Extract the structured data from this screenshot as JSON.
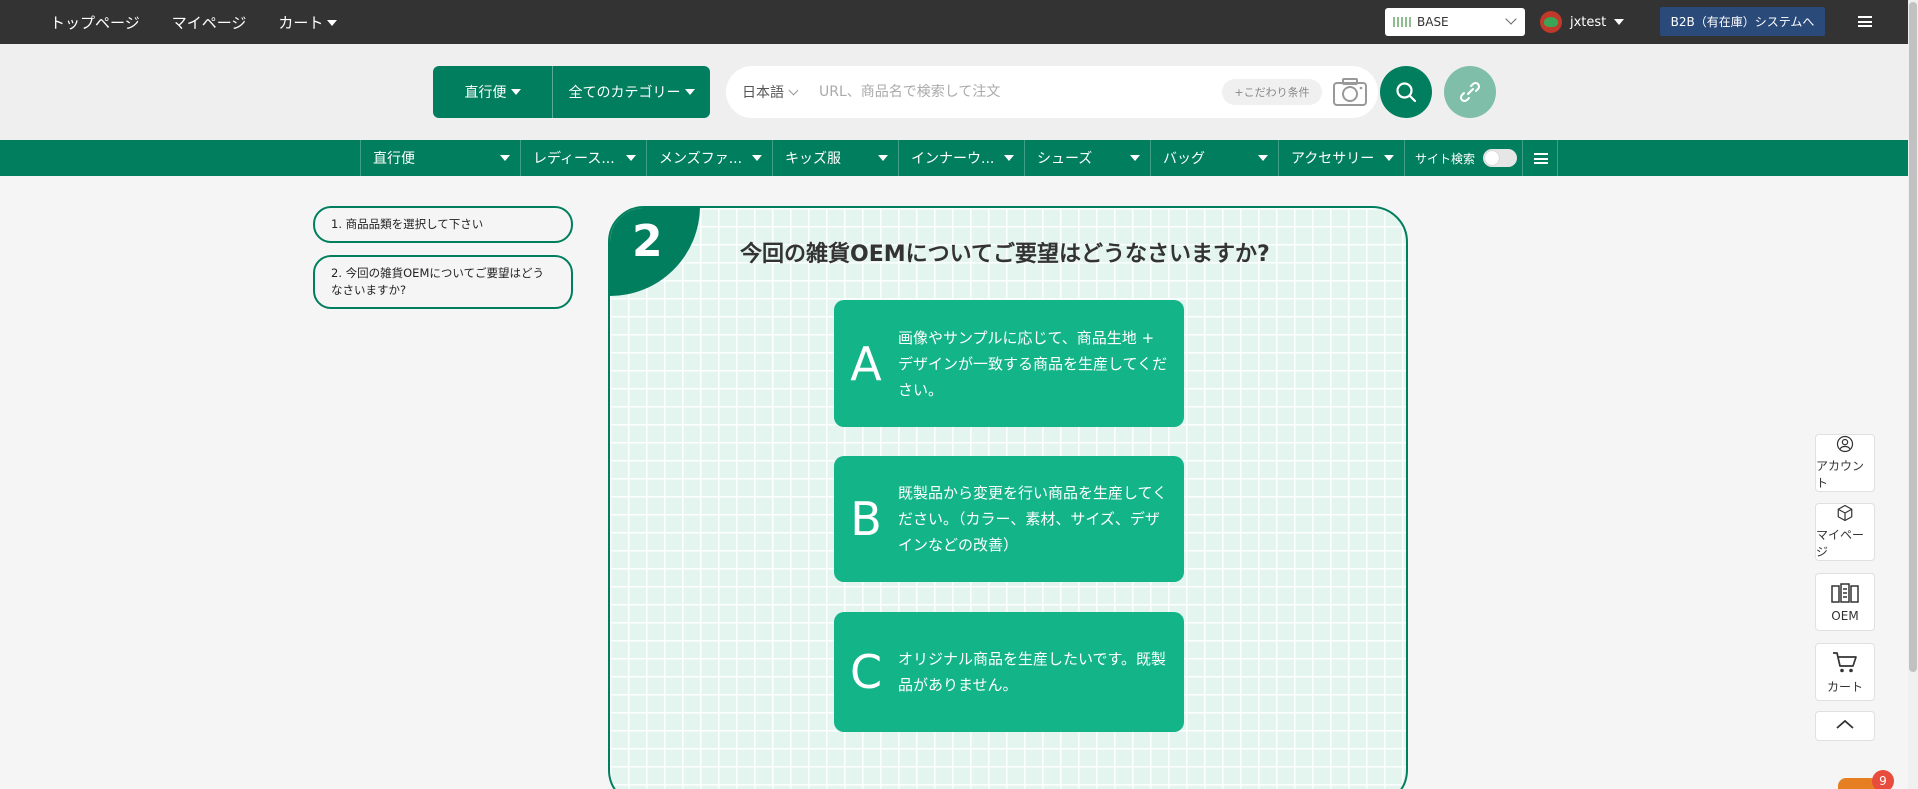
{
  "topbar": {
    "nav": [
      "トップページ",
      "マイページ",
      "カート"
    ],
    "store_select": "BASE",
    "username": "jxtest",
    "b2b_button": "B2B（有在庫）システムへ"
  },
  "search": {
    "route_label": "直行便",
    "category_label": "全てのカテゴリー",
    "language": "日本語",
    "placeholder": "URL、商品名で検索して注文",
    "kodawari": "+こだわり条件"
  },
  "categories": [
    "直行便",
    "レディース...",
    "メンズファ...",
    "キッズ服",
    "インナーウ...",
    "シューズ",
    "バッグ",
    "アクセサリー"
  ],
  "site_search_label": "サイト検索",
  "steps": [
    "1. 商品品類を選択して下さい",
    "2. 今回の雑貨OEMについてご要望はどうなさいますか?"
  ],
  "panel": {
    "step_number": "2",
    "question": "今回の雑貨OEMについてご要望はどうなさいますか?",
    "options": [
      {
        "letter": "A",
        "text": "画像やサンプルに応じて、商品生地 + デザインが一致する商品を生産してください。"
      },
      {
        "letter": "B",
        "text": "既製品から変更を行い商品を生産してください。（カラー、素材、サイズ、デザインなどの改善）"
      },
      {
        "letter": "C",
        "text": "オリジナル商品を生産したいです。既製品がありません。"
      }
    ]
  },
  "side_tools": [
    "アカウント",
    "マイページ",
    "OEM",
    "カート"
  ],
  "notification_count": "9",
  "colors": {
    "brand": "#007e5d",
    "option": "#13b488",
    "topbar": "#333333"
  }
}
